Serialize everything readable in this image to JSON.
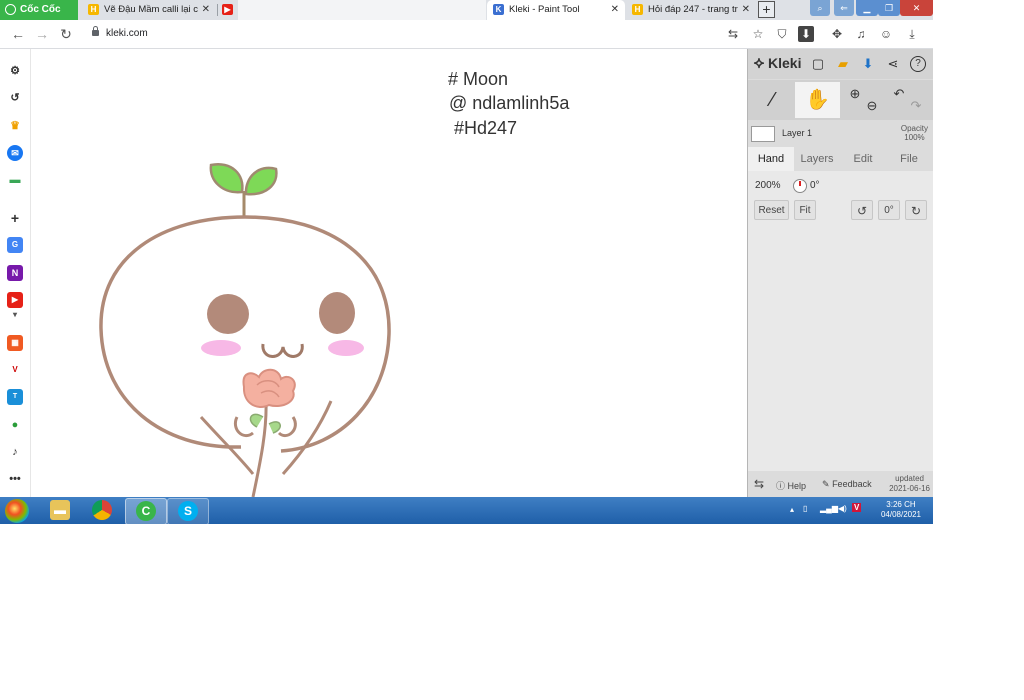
{
  "browser": {
    "brand": "Cốc Cốc",
    "tabs": [
      {
        "title": "Vẽ Đậu Mầm calli lại c",
        "active": false
      },
      {
        "title": "",
        "active": false
      },
      {
        "title": "Kleki - Paint Tool",
        "active": true
      },
      {
        "title": "Hỏi đáp 247 - trang tr",
        "active": false
      }
    ],
    "url": "kleki.com"
  },
  "drawing": {
    "lines": [
      "# Moon",
      "@ ndlamlinh5a",
      " #Hd247"
    ]
  },
  "kleki": {
    "logo": "Kleki",
    "layer_name": "Layer 1",
    "opacity_label": "Opacity",
    "opacity_value": "100%",
    "tabs": [
      {
        "label": "Hand",
        "active": true
      },
      {
        "label": "Layers",
        "active": false
      },
      {
        "label": "Edit",
        "active": false
      },
      {
        "label": "File",
        "active": false
      }
    ],
    "zoom": "200%",
    "rotation": "0°",
    "buttons": {
      "reset": "Reset",
      "fit": "Fit",
      "zero": "0°"
    },
    "footer": {
      "help": "Help",
      "feedback": "Feedback",
      "updated_label": "updated",
      "updated_date": "2021-06-16"
    }
  },
  "taskbar": {
    "time": "3:26 CH",
    "date": "04/08/2021"
  },
  "colors": {
    "coccoc_green": "#39b54a",
    "sprout_green": "#7ed957",
    "outline_brown": "#b08a78",
    "eye_brown": "#b38a7a",
    "blush_pink": "#f7b8e6",
    "rose_pink": "#f4b0a0",
    "taskbar_blue": "#2a6db5"
  }
}
